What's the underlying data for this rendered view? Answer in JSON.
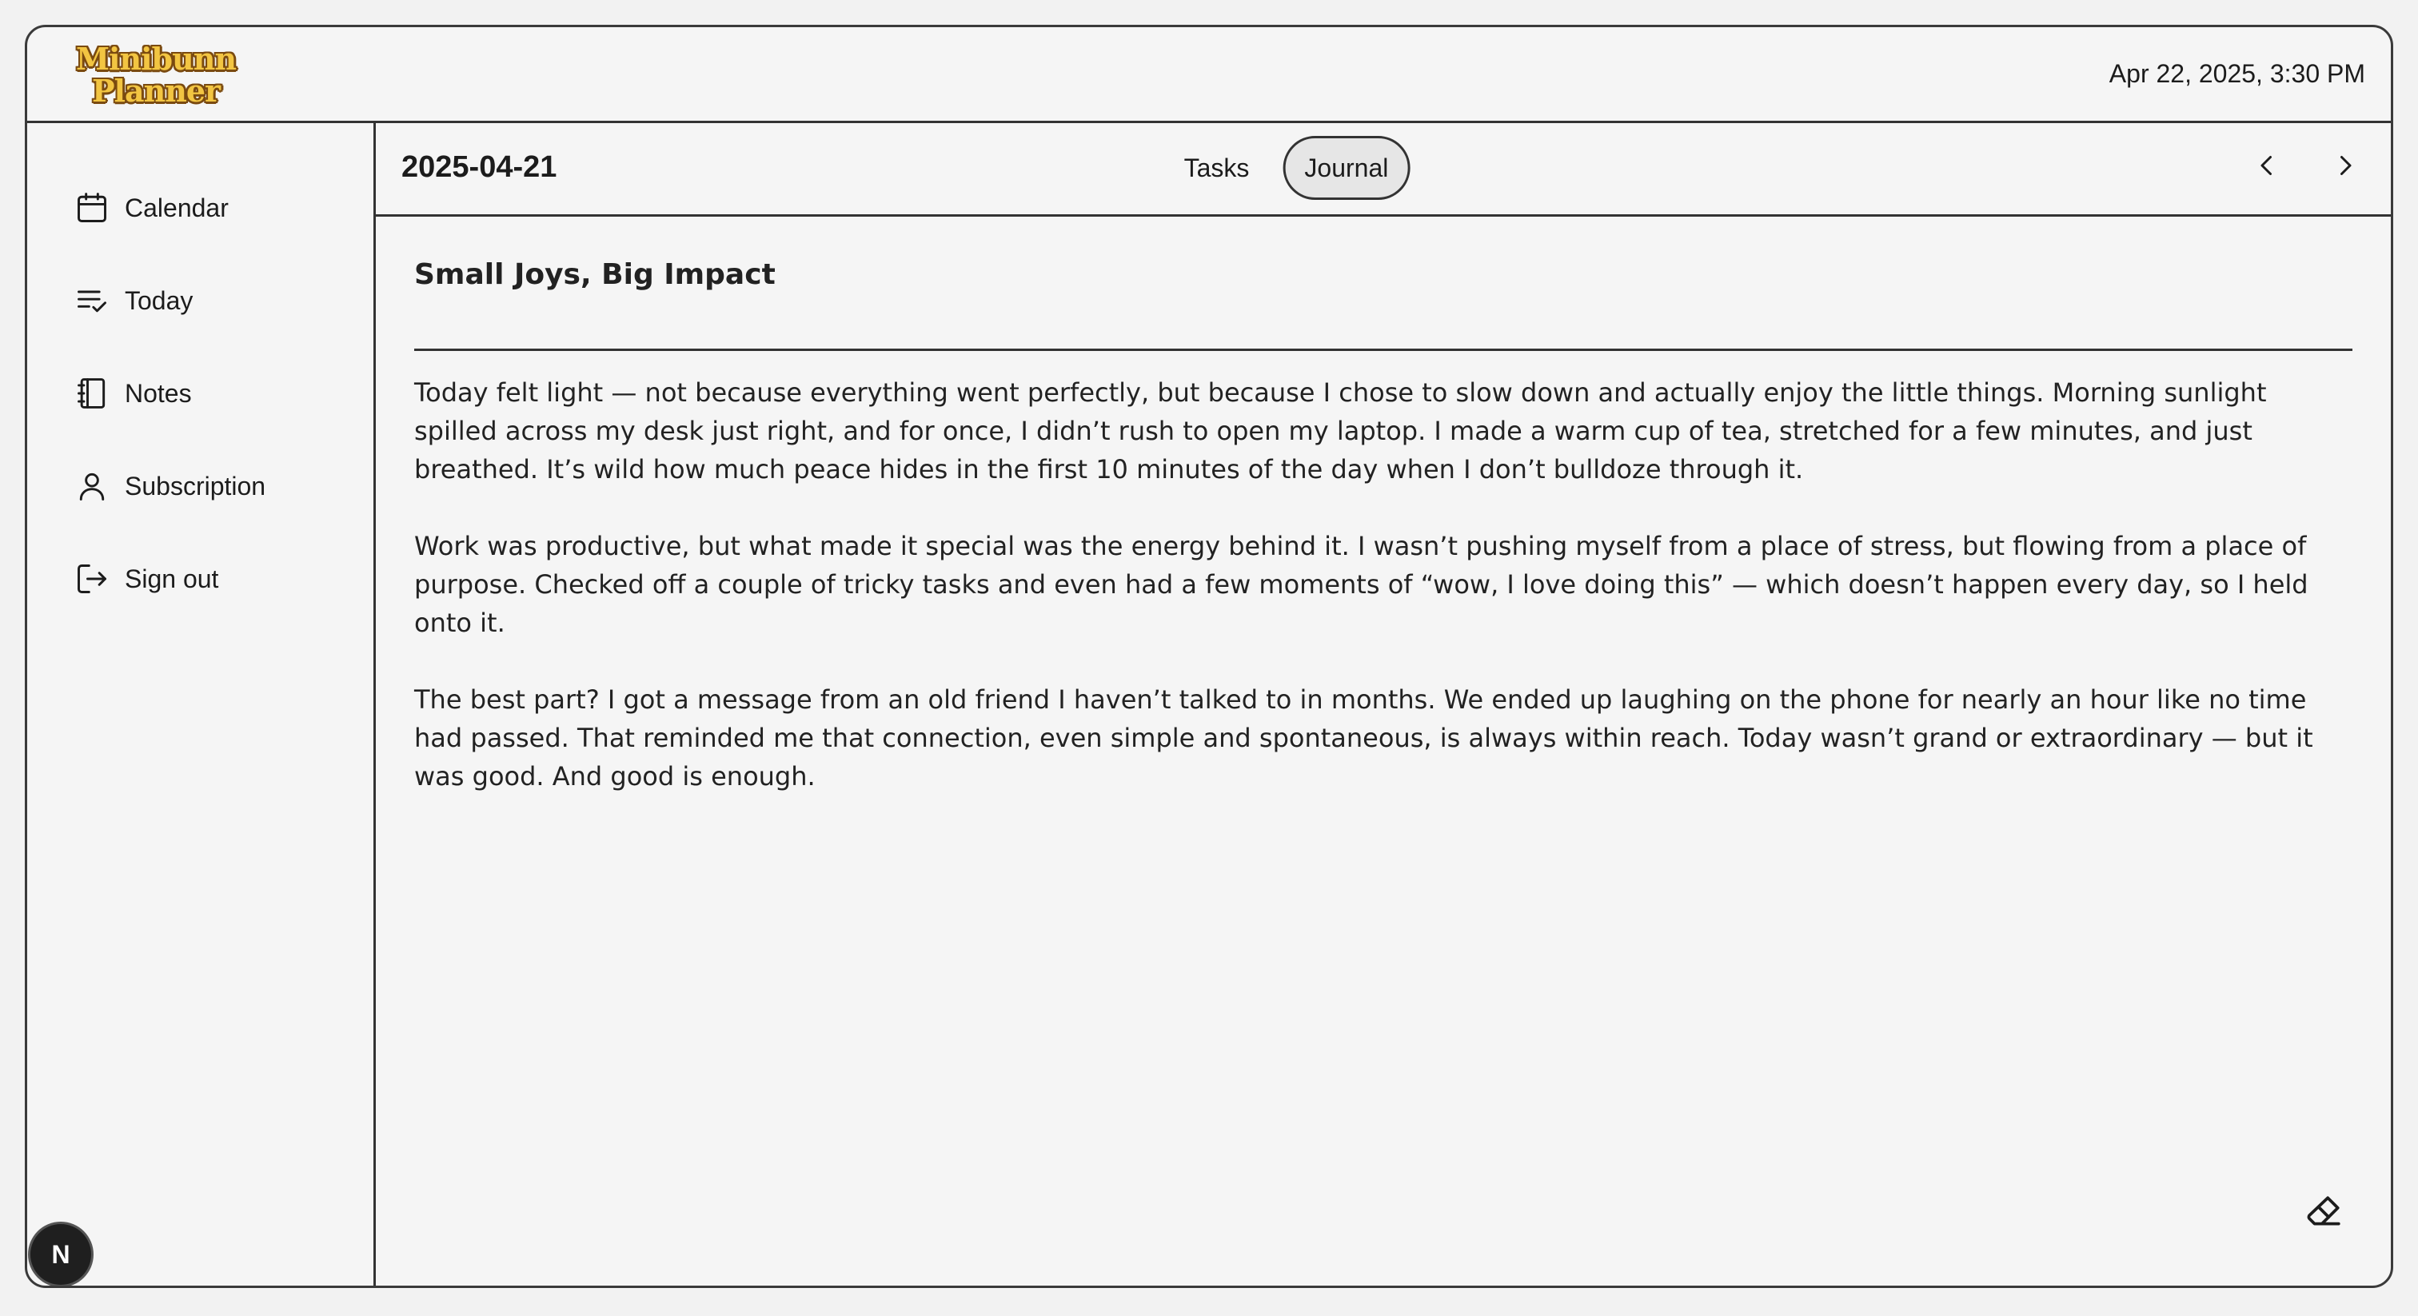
{
  "app": {
    "logo_line1": "Minibunn",
    "logo_line2": "Planner",
    "datetime": "Apr 22, 2025, 3:30 PM"
  },
  "sidebar": {
    "items": [
      {
        "label": "Calendar",
        "icon": "calendar-icon"
      },
      {
        "label": "Today",
        "icon": "checklist-icon"
      },
      {
        "label": "Notes",
        "icon": "notebook-icon"
      },
      {
        "label": "Subscription",
        "icon": "user-icon"
      },
      {
        "label": "Sign out",
        "icon": "sign-out-icon"
      }
    ],
    "avatar_letter": "N"
  },
  "main": {
    "date": "2025-04-21",
    "tabs": [
      {
        "label": "Tasks",
        "active": false
      },
      {
        "label": "Journal",
        "active": true
      }
    ]
  },
  "journal": {
    "title": "Small Joys, Big Impact",
    "paragraphs": [
      "Today felt light — not because everything went perfectly, but because I chose to slow down and actually enjoy the little things. Morning sunlight spilled across my desk just right, and for once, I didn’t rush to open my laptop. I made a warm cup of tea, stretched for a few minutes, and just breathed. It’s wild how much peace hides in the first 10 minutes of the day when I don’t bulldoze through it.",
      "Work was productive, but what made it special was the energy behind it. I wasn’t pushing myself from a place of stress, but flowing from a place of purpose. Checked off a couple of tricky tasks and even had a few moments of “wow, I love doing this” — which doesn’t happen every day, so I held onto it.",
      "The best part? I got a message from an old friend I haven’t talked to in months. We ended up laughing on the phone for nearly an hour like no time had passed. That reminded me that connection, even simple and spontaneous, is always within reach. Today wasn’t grand or extraordinary — but it was good. And good is enough."
    ]
  }
}
